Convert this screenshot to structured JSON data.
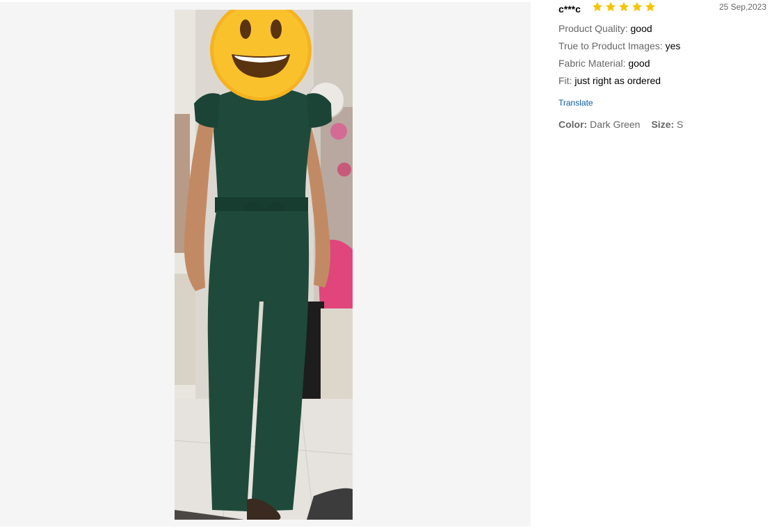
{
  "review": {
    "username": "c***c",
    "rating": 5,
    "date": "25 Sep,2023",
    "attributes": [
      {
        "label": "Product Quality:",
        "value": "good"
      },
      {
        "label": "True to Product Images:",
        "value": "yes"
      },
      {
        "label": "Fabric Material:",
        "value": "good"
      },
      {
        "label": "Fit:",
        "value": "just right as ordered"
      }
    ],
    "translate_label": "Translate",
    "sku": {
      "color_label": "Color:",
      "color_value": "Dark Green",
      "size_label": "Size:",
      "size_value": "S"
    }
  },
  "colors": {
    "star": "#f5c400",
    "link": "#0a5a9c",
    "jumpsuit": "#1f4a3b"
  }
}
